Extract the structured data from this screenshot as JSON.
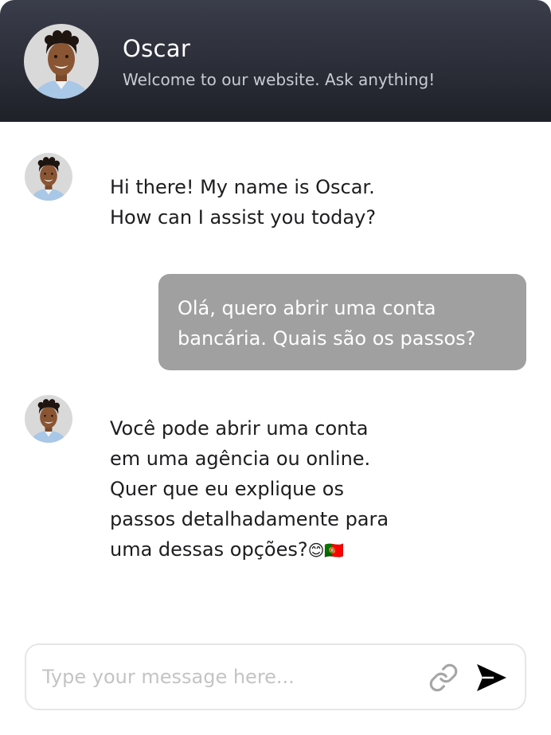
{
  "header": {
    "name": "Oscar",
    "subtitle": "Welcome to our website. Ask anything!"
  },
  "messages": [
    {
      "from": "bot",
      "text": "Hi there!  My name is Oscar.\nHow can I assist you today?"
    },
    {
      "from": "user",
      "text": "Olá, quero abrir uma conta\nbancária. Quais são os passos?"
    },
    {
      "from": "bot",
      "text": "Você pode abrir uma conta\nem uma agência ou online.\nQuer que eu explique os\npassos detalhadamente para\numa dessas opções?",
      "emoji": "😊🇵🇹"
    }
  ],
  "composer": {
    "placeholder": "Type your message here..."
  },
  "icons": {
    "attach": "link-icon",
    "send": "send-icon"
  },
  "colors": {
    "header_top": "#3a3d4a",
    "header_bottom": "#1f2129",
    "user_bubble": "#a0a0a0",
    "text": "#1d1d1f"
  }
}
